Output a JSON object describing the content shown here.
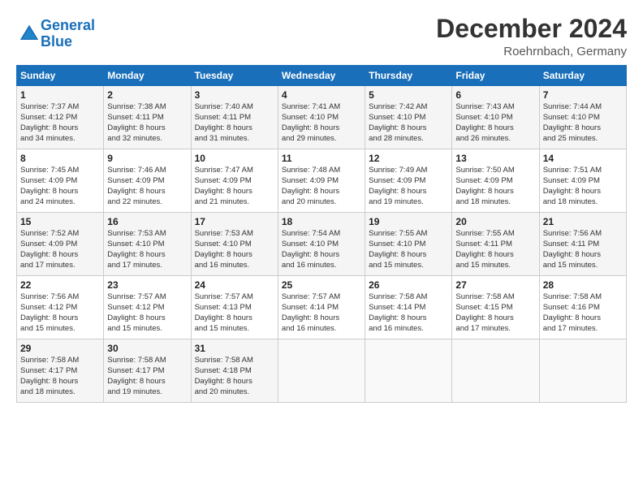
{
  "header": {
    "logo_line1": "General",
    "logo_line2": "Blue",
    "month": "December 2024",
    "location": "Roehrnbach, Germany"
  },
  "weekdays": [
    "Sunday",
    "Monday",
    "Tuesday",
    "Wednesday",
    "Thursday",
    "Friday",
    "Saturday"
  ],
  "weeks": [
    [
      {
        "day": "1",
        "lines": [
          "Sunrise: 7:37 AM",
          "Sunset: 4:12 PM",
          "Daylight: 8 hours",
          "and 34 minutes."
        ]
      },
      {
        "day": "2",
        "lines": [
          "Sunrise: 7:38 AM",
          "Sunset: 4:11 PM",
          "Daylight: 8 hours",
          "and 32 minutes."
        ]
      },
      {
        "day": "3",
        "lines": [
          "Sunrise: 7:40 AM",
          "Sunset: 4:11 PM",
          "Daylight: 8 hours",
          "and 31 minutes."
        ]
      },
      {
        "day": "4",
        "lines": [
          "Sunrise: 7:41 AM",
          "Sunset: 4:10 PM",
          "Daylight: 8 hours",
          "and 29 minutes."
        ]
      },
      {
        "day": "5",
        "lines": [
          "Sunrise: 7:42 AM",
          "Sunset: 4:10 PM",
          "Daylight: 8 hours",
          "and 28 minutes."
        ]
      },
      {
        "day": "6",
        "lines": [
          "Sunrise: 7:43 AM",
          "Sunset: 4:10 PM",
          "Daylight: 8 hours",
          "and 26 minutes."
        ]
      },
      {
        "day": "7",
        "lines": [
          "Sunrise: 7:44 AM",
          "Sunset: 4:10 PM",
          "Daylight: 8 hours",
          "and 25 minutes."
        ]
      }
    ],
    [
      {
        "day": "8",
        "lines": [
          "Sunrise: 7:45 AM",
          "Sunset: 4:09 PM",
          "Daylight: 8 hours",
          "and 24 minutes."
        ]
      },
      {
        "day": "9",
        "lines": [
          "Sunrise: 7:46 AM",
          "Sunset: 4:09 PM",
          "Daylight: 8 hours",
          "and 22 minutes."
        ]
      },
      {
        "day": "10",
        "lines": [
          "Sunrise: 7:47 AM",
          "Sunset: 4:09 PM",
          "Daylight: 8 hours",
          "and 21 minutes."
        ]
      },
      {
        "day": "11",
        "lines": [
          "Sunrise: 7:48 AM",
          "Sunset: 4:09 PM",
          "Daylight: 8 hours",
          "and 20 minutes."
        ]
      },
      {
        "day": "12",
        "lines": [
          "Sunrise: 7:49 AM",
          "Sunset: 4:09 PM",
          "Daylight: 8 hours",
          "and 19 minutes."
        ]
      },
      {
        "day": "13",
        "lines": [
          "Sunrise: 7:50 AM",
          "Sunset: 4:09 PM",
          "Daylight: 8 hours",
          "and 18 minutes."
        ]
      },
      {
        "day": "14",
        "lines": [
          "Sunrise: 7:51 AM",
          "Sunset: 4:09 PM",
          "Daylight: 8 hours",
          "and 18 minutes."
        ]
      }
    ],
    [
      {
        "day": "15",
        "lines": [
          "Sunrise: 7:52 AM",
          "Sunset: 4:09 PM",
          "Daylight: 8 hours",
          "and 17 minutes."
        ]
      },
      {
        "day": "16",
        "lines": [
          "Sunrise: 7:53 AM",
          "Sunset: 4:10 PM",
          "Daylight: 8 hours",
          "and 17 minutes."
        ]
      },
      {
        "day": "17",
        "lines": [
          "Sunrise: 7:53 AM",
          "Sunset: 4:10 PM",
          "Daylight: 8 hours",
          "and 16 minutes."
        ]
      },
      {
        "day": "18",
        "lines": [
          "Sunrise: 7:54 AM",
          "Sunset: 4:10 PM",
          "Daylight: 8 hours",
          "and 16 minutes."
        ]
      },
      {
        "day": "19",
        "lines": [
          "Sunrise: 7:55 AM",
          "Sunset: 4:10 PM",
          "Daylight: 8 hours",
          "and 15 minutes."
        ]
      },
      {
        "day": "20",
        "lines": [
          "Sunrise: 7:55 AM",
          "Sunset: 4:11 PM",
          "Daylight: 8 hours",
          "and 15 minutes."
        ]
      },
      {
        "day": "21",
        "lines": [
          "Sunrise: 7:56 AM",
          "Sunset: 4:11 PM",
          "Daylight: 8 hours",
          "and 15 minutes."
        ]
      }
    ],
    [
      {
        "day": "22",
        "lines": [
          "Sunrise: 7:56 AM",
          "Sunset: 4:12 PM",
          "Daylight: 8 hours",
          "and 15 minutes."
        ]
      },
      {
        "day": "23",
        "lines": [
          "Sunrise: 7:57 AM",
          "Sunset: 4:12 PM",
          "Daylight: 8 hours",
          "and 15 minutes."
        ]
      },
      {
        "day": "24",
        "lines": [
          "Sunrise: 7:57 AM",
          "Sunset: 4:13 PM",
          "Daylight: 8 hours",
          "and 15 minutes."
        ]
      },
      {
        "day": "25",
        "lines": [
          "Sunrise: 7:57 AM",
          "Sunset: 4:14 PM",
          "Daylight: 8 hours",
          "and 16 minutes."
        ]
      },
      {
        "day": "26",
        "lines": [
          "Sunrise: 7:58 AM",
          "Sunset: 4:14 PM",
          "Daylight: 8 hours",
          "and 16 minutes."
        ]
      },
      {
        "day": "27",
        "lines": [
          "Sunrise: 7:58 AM",
          "Sunset: 4:15 PM",
          "Daylight: 8 hours",
          "and 17 minutes."
        ]
      },
      {
        "day": "28",
        "lines": [
          "Sunrise: 7:58 AM",
          "Sunset: 4:16 PM",
          "Daylight: 8 hours",
          "and 17 minutes."
        ]
      }
    ],
    [
      {
        "day": "29",
        "lines": [
          "Sunrise: 7:58 AM",
          "Sunset: 4:17 PM",
          "Daylight: 8 hours",
          "and 18 minutes."
        ]
      },
      {
        "day": "30",
        "lines": [
          "Sunrise: 7:58 AM",
          "Sunset: 4:17 PM",
          "Daylight: 8 hours",
          "and 19 minutes."
        ]
      },
      {
        "day": "31",
        "lines": [
          "Sunrise: 7:58 AM",
          "Sunset: 4:18 PM",
          "Daylight: 8 hours",
          "and 20 minutes."
        ]
      },
      null,
      null,
      null,
      null
    ]
  ]
}
